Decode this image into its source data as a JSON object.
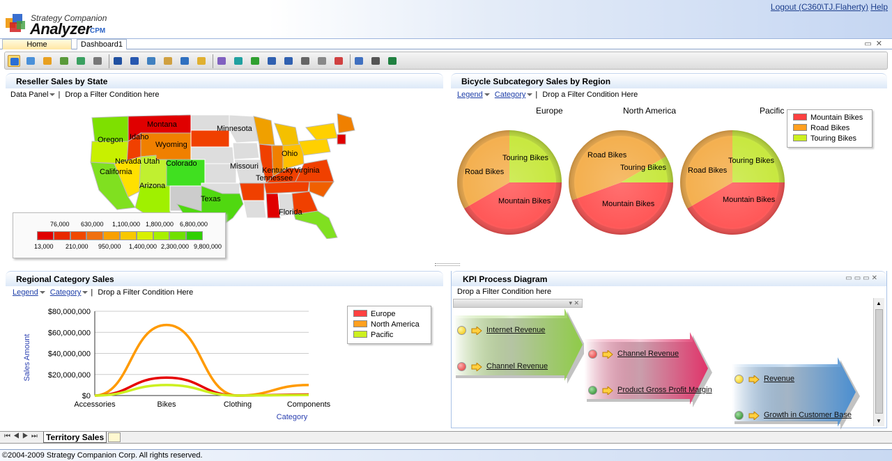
{
  "app": {
    "logo_sub": "Strategy Companion",
    "logo_main": "Analyzer",
    "logo_cpm": "CPM",
    "logout": "Logout (C360\\TJ.Flaherty)",
    "help": "Help"
  },
  "tabs": [
    {
      "label": "Home"
    },
    {
      "label": "Dashboard1"
    }
  ],
  "toolbar": {
    "icons": [
      "globe-icon",
      "grid-icon",
      "tree-icon",
      "cube-icon",
      "export-icon",
      "pivot-icon",
      "save-icon",
      "save-as-icon",
      "open-icon",
      "notes-icon",
      "layout-icon",
      "folder-icon",
      "edit-icon",
      "filter-icon",
      "refresh-icon",
      "zoom-in-icon",
      "zoom-out-icon",
      "list-icon",
      "select-icon",
      "color-icon",
      "calendar-icon",
      "print-icon",
      "excel-icon"
    ]
  },
  "map_panel": {
    "title": "Reseller Sales by State",
    "data_panel": "Data Panel",
    "filter": "Drop a Filter Condition here",
    "states": [
      "Montana",
      "Idaho",
      "Oregon",
      "Wyoming",
      "Nevada",
      "Utah",
      "California",
      "Colorado",
      "Arizona",
      "Texas",
      "Minnesota",
      "Missouri",
      "Ohio",
      "Kentucky",
      "Virginia",
      "Tennessee",
      "Florida"
    ],
    "scale_top": [
      "76,000",
      "630,000",
      "1,100,000",
      "1,800,000",
      "6,800,000"
    ],
    "scale_bottom": [
      "13,000",
      "210,000",
      "950,000",
      "1,400,000",
      "2,300,000",
      "9,800,000"
    ],
    "scale_colors": [
      "#e00000",
      "#e82800",
      "#f04800",
      "#f07010",
      "#f8a000",
      "#f8c800",
      "#d8f000",
      "#a8f000",
      "#70e000",
      "#30d000"
    ]
  },
  "pie_panel": {
    "title": "Bicycle Subcategory Sales by Region",
    "legend_link": "Legend",
    "category_link": "Category",
    "filter": "Drop a Filter Condition Here",
    "regions": [
      "Europe",
      "North America",
      "Pacific"
    ],
    "labels": {
      "touring": "Touring Bikes",
      "road": "Road Bikes",
      "mountain": "Mountain Bikes"
    },
    "legend": [
      {
        "name": "Mountain Bikes",
        "color": "#ff4040"
      },
      {
        "name": "Road Bikes",
        "color": "#ffa020"
      },
      {
        "name": "Touring Bikes",
        "color": "#ccf020"
      }
    ]
  },
  "line_panel": {
    "title": "Regional Category Sales",
    "legend_link": "Legend",
    "category_link": "Category",
    "filter": "Drop a Filter Condition Here",
    "legend": [
      {
        "name": "Europe",
        "color": "#ff4040"
      },
      {
        "name": "North America",
        "color": "#ffa020"
      },
      {
        "name": "Pacific",
        "color": "#ccf020"
      }
    ]
  },
  "chart_data": {
    "type": "line",
    "categories": [
      "Accessories",
      "Bikes",
      "Clothing",
      "Components"
    ],
    "series": [
      {
        "name": "North America",
        "values": [
          0,
          67000000,
          0,
          10000000
        ],
        "color": "#ff9a00"
      },
      {
        "name": "Europe",
        "values": [
          0,
          17000000,
          0,
          1000000
        ],
        "color": "#e60000"
      },
      {
        "name": "Pacific",
        "values": [
          0,
          10000000,
          0,
          500000
        ],
        "color": "#ccf020"
      }
    ],
    "xlabel": "Category",
    "ylabel": "Sales Amount",
    "ylim": [
      0,
      80000000
    ],
    "yticks": [
      "$80,000,000",
      "$60,000,000",
      "$40,000,000",
      "$20,000,000",
      "$0"
    ],
    "grid": true,
    "legend": "right"
  },
  "kpi_panel": {
    "title": "KPI Process Diagram",
    "filter": "Drop a Filter Condition here",
    "items": [
      {
        "label": "Internet Revenue",
        "status": "yellow"
      },
      {
        "label": "Channel Revenue",
        "status": "red"
      },
      {
        "label": "Channel Revenue",
        "status": "red"
      },
      {
        "label": "Product Gross Profit Margin",
        "status": "green"
      },
      {
        "label": "Revenue",
        "status": "yellow"
      },
      {
        "label": "Growth in Customer Base",
        "status": "green"
      }
    ]
  },
  "sheets": {
    "active": "Territory Sales"
  },
  "footer": {
    "copyright": "©2004-2009 Strategy Companion Corp. All rights reserved."
  }
}
